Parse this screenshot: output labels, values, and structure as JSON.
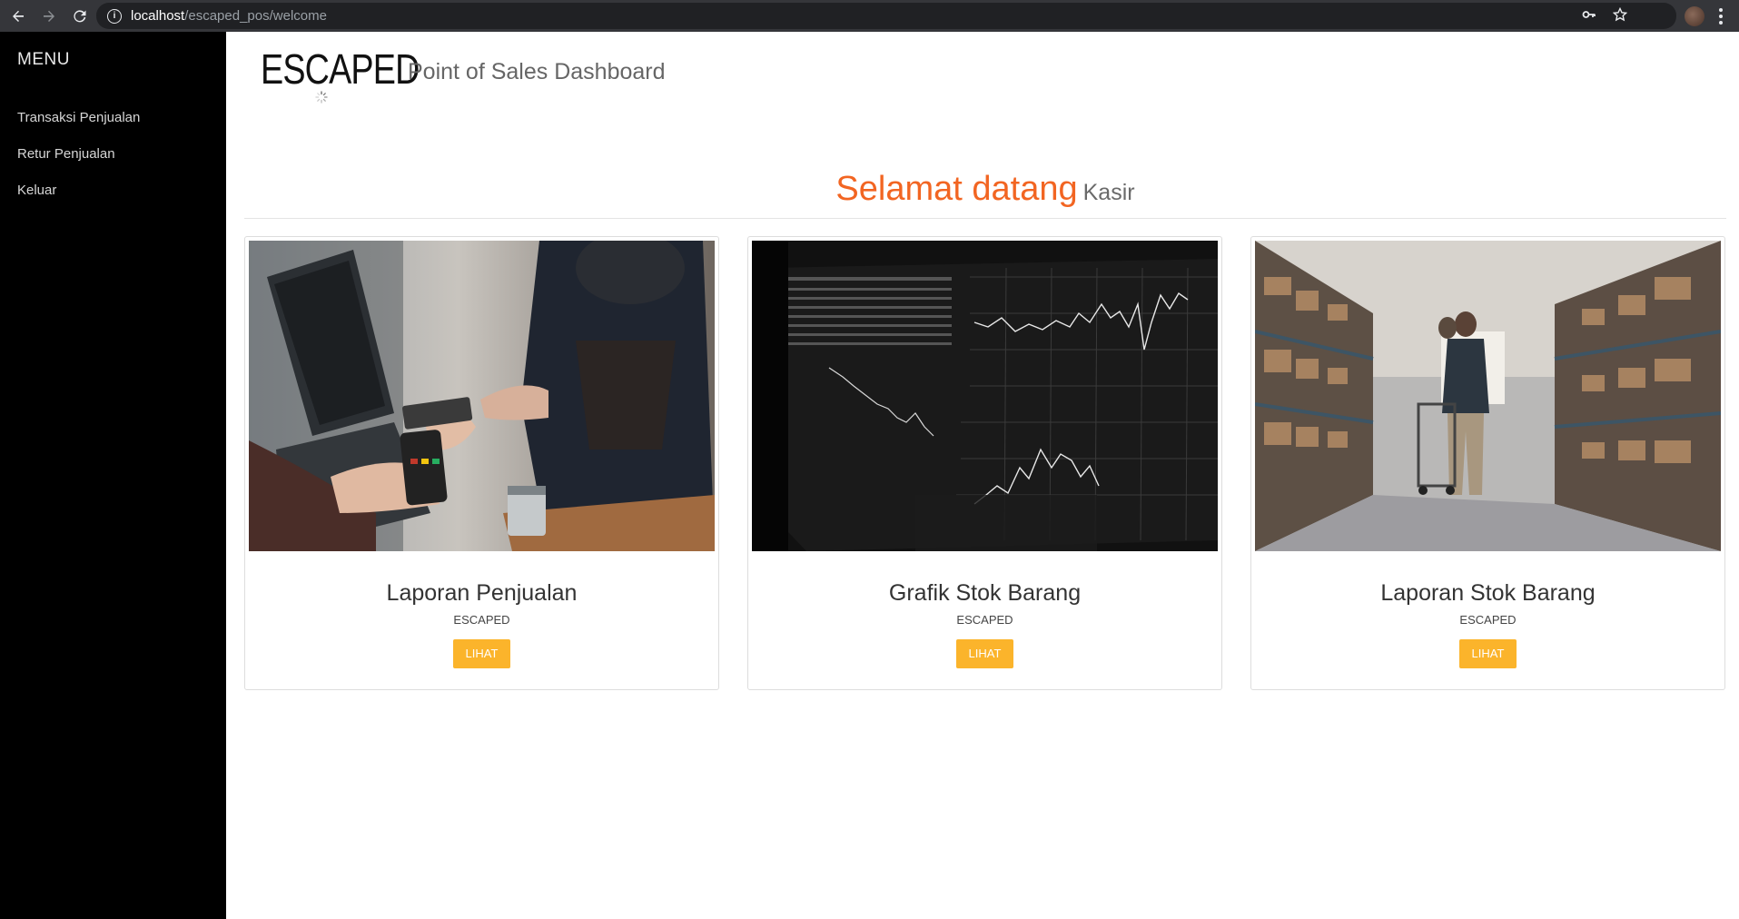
{
  "browser": {
    "url_host": "localhost",
    "url_path": "/escaped_pos/welcome"
  },
  "sidebar": {
    "title": "MENU",
    "items": [
      {
        "label": "Transaksi Penjualan"
      },
      {
        "label": "Retur Penjualan"
      },
      {
        "label": "Keluar"
      }
    ]
  },
  "header": {
    "brand": "ESCAPED",
    "subtitle": "Point of Sales Dashboard"
  },
  "welcome": {
    "greeting": "Selamat datang",
    "role": "Kasir"
  },
  "cards": [
    {
      "title": "Laporan Penjualan",
      "brand": "ESCAPED",
      "button": "LIHAT"
    },
    {
      "title": "Grafik Stok Barang",
      "brand": "ESCAPED",
      "button": "LIHAT"
    },
    {
      "title": "Laporan Stok Barang",
      "brand": "ESCAPED",
      "button": "LIHAT"
    }
  ],
  "colors": {
    "accent": "#f26522",
    "button": "#fbb42b",
    "sidebar_bg": "#000000"
  }
}
